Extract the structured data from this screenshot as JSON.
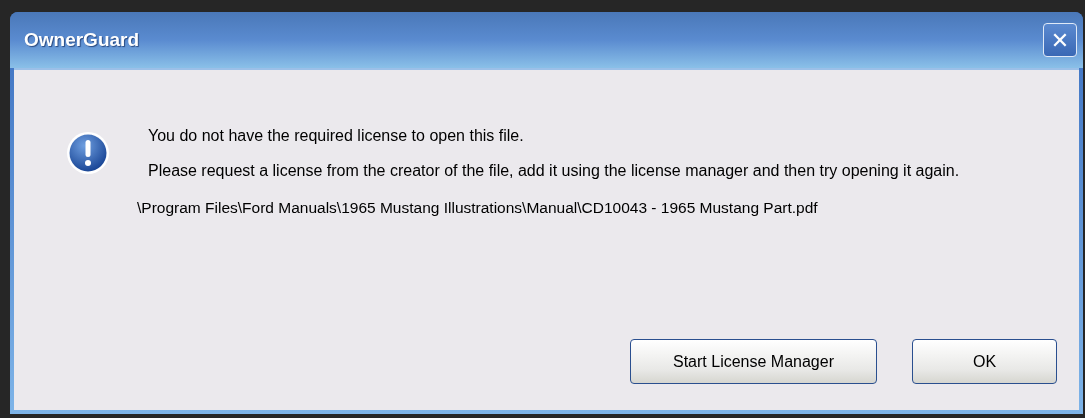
{
  "window": {
    "title": "OwnerGuard",
    "close": "✕"
  },
  "message": {
    "kind": "warning",
    "lines": [
      "You do not have the required license to open this file.",
      "Please request a license from the creator of the file, add it using the license manager and then try opening it again."
    ],
    "path": "\\Program Files\\Ford Manuals\\1965 Mustang Illustrations\\Manual\\CD10043 - 1965 Mustang Part.pdf"
  },
  "buttons": [
    {
      "label": "Start License Manager"
    },
    {
      "label": "OK"
    }
  ]
}
